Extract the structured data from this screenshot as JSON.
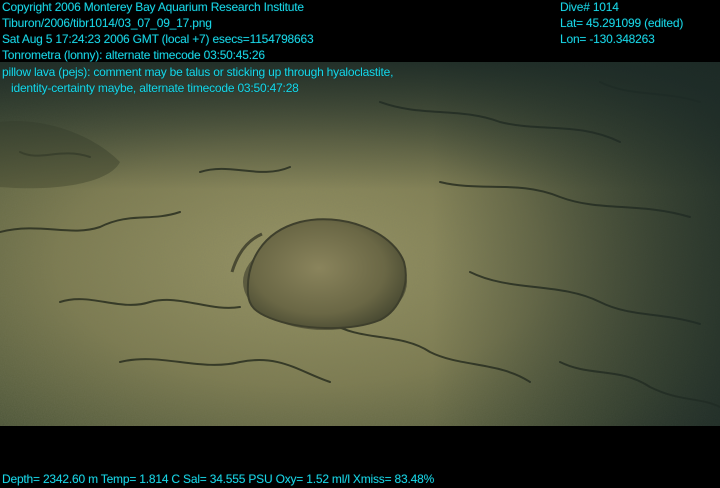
{
  "header_left": [
    "Copyright 2006 Monterey Bay Aquarium Research Institute",
    "Tiburon/2006/tibr1014/03_07_09_17.png",
    "Sat Aug  5 17:24:23 2006 GMT (local +7)  esecs=1154798663",
    "Tonrometra (lonny): alternate timecode 03:50:45:26"
  ],
  "header_right": [
    "Dive# 1014",
    "Lat= 45.291099 (edited)",
    "Lon= -130.348263"
  ],
  "annotation": [
    "pillow lava (pejs): comment may be talus or sticking up through hyaloclastite,",
    "identity-certainty maybe, alternate timecode 03:50:47:28"
  ],
  "footer": "Depth= 2342.60 m  Temp= 1.814 C  Sal= 34.555 PSU  Oxy= 1.52 ml/l  Xmiss= 83.48%",
  "colors": {
    "overlay_text": "#19d6e6",
    "seafloor_light": "#8c8a5a",
    "seafloor_dark": "#2f3a2c"
  }
}
